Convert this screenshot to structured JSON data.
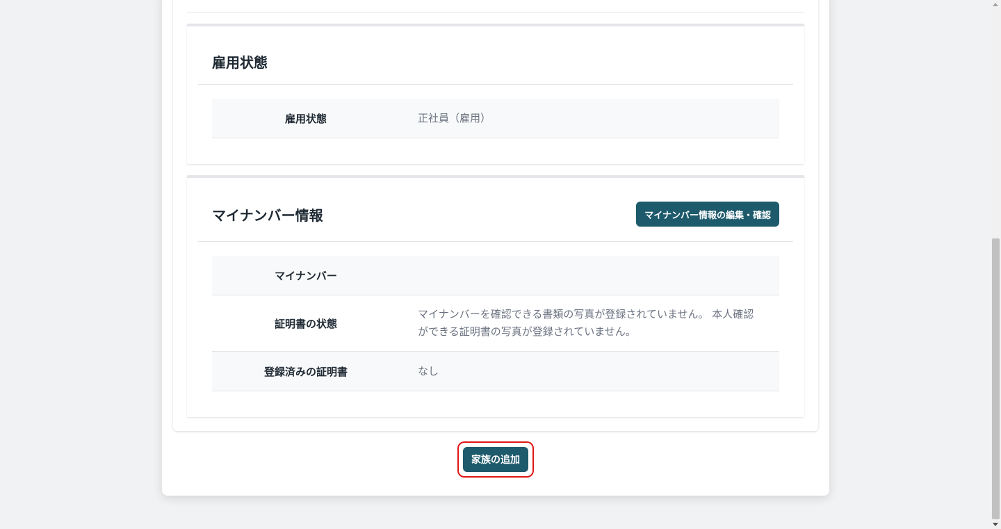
{
  "employment_section": {
    "title": "雇用状態",
    "rows": [
      {
        "label": "雇用状態",
        "value": "正社員（雇用）"
      }
    ]
  },
  "mynumber_section": {
    "title": "マイナンバー情報",
    "edit_button_label": "マイナンバー情報の編集・確認",
    "rows": [
      {
        "label": "マイナンバー",
        "value": ""
      },
      {
        "label": "証明書の状態",
        "value": "マイナンバーを確認できる書類の写真が登録されていません。 本人確認ができる証明書の写真が登録されていません。"
      },
      {
        "label": "登録済みの証明書",
        "value": "なし"
      }
    ]
  },
  "footer": {
    "add_family_button_label": "家族の追加"
  },
  "colors": {
    "primary_button": "#1d5a6c",
    "highlight_border": "#e01616"
  }
}
